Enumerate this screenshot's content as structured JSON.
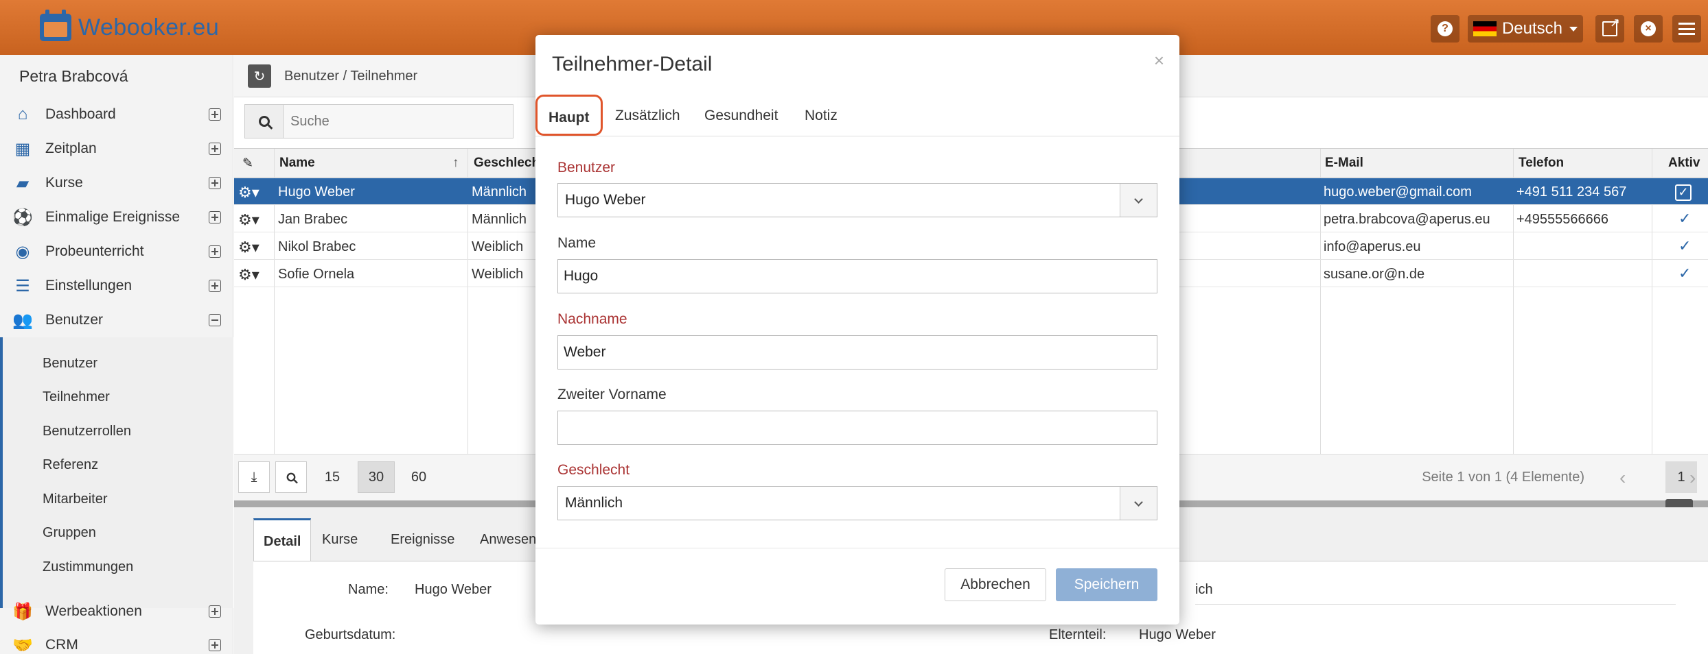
{
  "app": {
    "logo_text": "Webooker.eu",
    "language": "Deutsch"
  },
  "colors": {
    "topbar": "#d0692a",
    "brand": "#2c67a8",
    "required_label": "#a33333",
    "tab_highlight": "#e0552b"
  },
  "sidebar": {
    "user": "Petra Brabcová",
    "items": [
      {
        "label": "Dashboard",
        "icon": "home-icon"
      },
      {
        "label": "Zeitplan",
        "icon": "calendar-icon"
      },
      {
        "label": "Kurse",
        "icon": "book-icon"
      },
      {
        "label": "Einmalige Ereignisse",
        "icon": "ball-icon"
      },
      {
        "label": "Probeunterricht",
        "icon": "eye-icon"
      },
      {
        "label": "Einstellungen",
        "icon": "server-icon"
      },
      {
        "label": "Benutzer",
        "icon": "users-icon"
      },
      {
        "label": "Werbeaktionen",
        "icon": "gift-icon"
      },
      {
        "label": "CRM",
        "icon": "handshake-icon"
      }
    ],
    "subitems": [
      "Benutzer",
      "Teilnehmer",
      "Benutzerrollen",
      "Referenz",
      "Mitarbeiter",
      "Gruppen",
      "Zustimmungen"
    ]
  },
  "main": {
    "breadcrumb": "Benutzer / Teilnehmer",
    "search_placeholder": "Suche",
    "columns": {
      "name": "Name",
      "gender": "Geschlech",
      "email": "E-Mail",
      "phone": "Telefon",
      "active": "Aktiv"
    },
    "rows": [
      {
        "name": "Hugo Weber",
        "gender": "Männlich",
        "email": "hugo.weber@gmail.com",
        "phone": "+491 511 234 567"
      },
      {
        "name": "Jan Brabec",
        "gender": "Männlich",
        "email": "petra.brabcova@aperus.eu",
        "phone": "+49555566666"
      },
      {
        "name": "Nikol Brabec",
        "gender": "Weiblich",
        "email": "info@aperus.eu",
        "phone": ""
      },
      {
        "name": "Sofie Ornela",
        "gender": "Weiblich",
        "email": "susane.or@n.de",
        "phone": ""
      }
    ],
    "page_sizes": [
      "15",
      "30",
      "60"
    ],
    "paging_text": "Seite 1 von 1 (4 Elemente)",
    "current_page": "1"
  },
  "detail": {
    "tabs": [
      "Detail",
      "Kurse",
      "Ereignisse",
      "Anwesen"
    ],
    "name_label": "Name:",
    "name_value": "Hugo Weber",
    "birth_label": "Geburtsdatum:",
    "partial_value": "ich",
    "parent_label": "Elternteil:",
    "parent_value": "Hugo Weber"
  },
  "modal": {
    "title": "Teilnehmer-Detail",
    "close": "×",
    "tabs": [
      "Haupt",
      "Zusätzlich",
      "Gesundheit",
      "Notiz"
    ],
    "fields": {
      "benutzer_label": "Benutzer",
      "benutzer_value": "Hugo Weber",
      "name_label": "Name",
      "name_value": "Hugo",
      "nachname_label": "Nachname",
      "nachname_value": "Weber",
      "zweiter_label": "Zweiter Vorname",
      "zweiter_value": "",
      "geschlecht_label": "Geschlecht",
      "geschlecht_value": "Männlich"
    },
    "cancel": "Abbrechen",
    "save": "Speichern"
  }
}
